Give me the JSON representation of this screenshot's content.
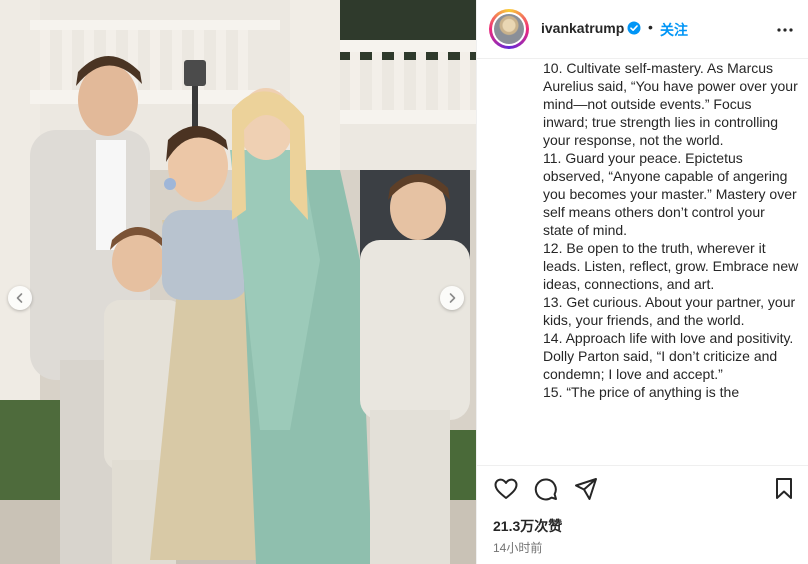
{
  "post": {
    "username": "ivankatrump",
    "separator": "•",
    "follow_label": "关注",
    "caption": "10. Cultivate self-mastery. As Marcus Aurelius said, “You have power over your mind—not outside events.” Focus inward; true strength lies in controlling your response, not the world.\n11. Guard your peace. Epictetus observed, “Anyone capable of angering you becomes your master.” Mastery over self means others don’t control your state of mind.\n12. Be open to the truth, wherever it leads. Listen, reflect, grow. Embrace new ideas, connections, and art.\n13. Get curious. About your partner, your kids, your friends, and the world.\n14. Approach life with love and positivity. Dolly Parton said, “I don’t criticize and condemn; I love and accept.”\n15. “The price of anything is the",
    "likes": "21.3万次赞",
    "time_ago": "14小时前"
  },
  "icons": {
    "verified": "verified-badge-icon",
    "more": "more-options-icon",
    "like": "heart-icon",
    "comment": "comment-icon",
    "share": "share-icon",
    "save": "bookmark-icon",
    "prev": "chevron-left-icon",
    "next": "chevron-right-icon"
  },
  "colors": {
    "accent": "#0095f6",
    "text": "#262626",
    "muted": "#737373",
    "divider": "#efefef"
  }
}
